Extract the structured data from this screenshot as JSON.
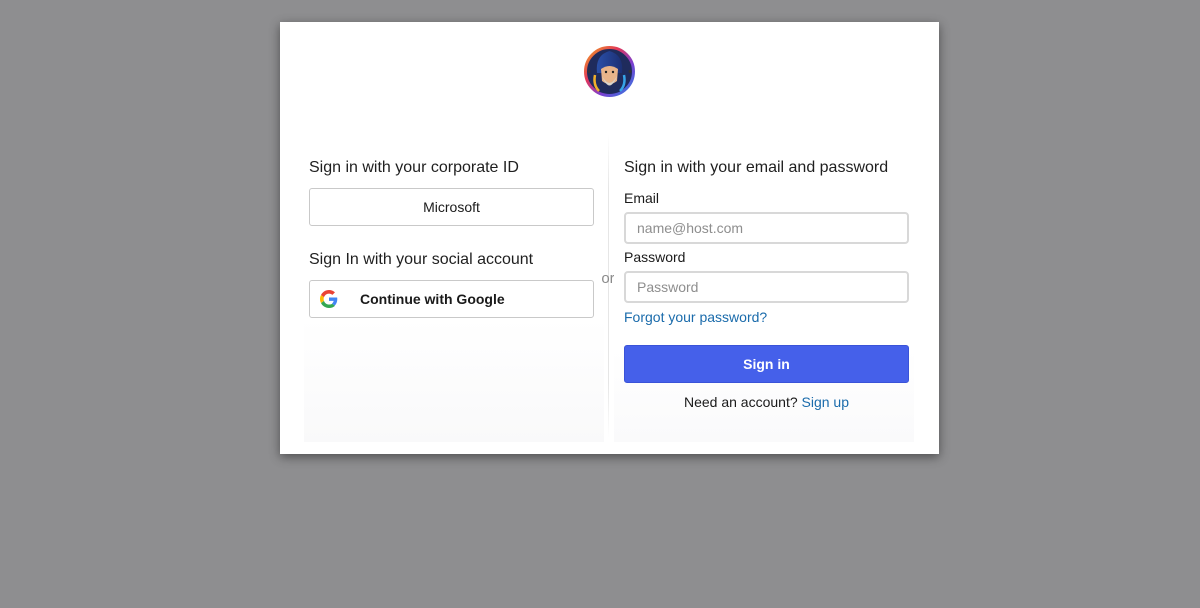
{
  "logo": {
    "icon": "wizard-avatar-logo"
  },
  "corporate": {
    "heading": "Sign in with your corporate ID",
    "button_label": "Microsoft"
  },
  "social": {
    "heading": "Sign In with your social account",
    "google_label": "Continue with Google",
    "google_icon": "google-g-icon"
  },
  "separator": {
    "label": "or"
  },
  "credentials": {
    "heading": "Sign in with your email and password",
    "email_label": "Email",
    "email_placeholder": "name@host.com",
    "email_value": "",
    "password_label": "Password",
    "password_placeholder": "Password",
    "password_value": "",
    "forgot_label": "Forgot your password?",
    "submit_label": "Sign in",
    "signup_prompt": "Need an account?",
    "signup_link": "Sign up"
  },
  "colors": {
    "page_background": "#8e8e90",
    "primary_button": "#4560ea",
    "link": "#1a6bab"
  }
}
